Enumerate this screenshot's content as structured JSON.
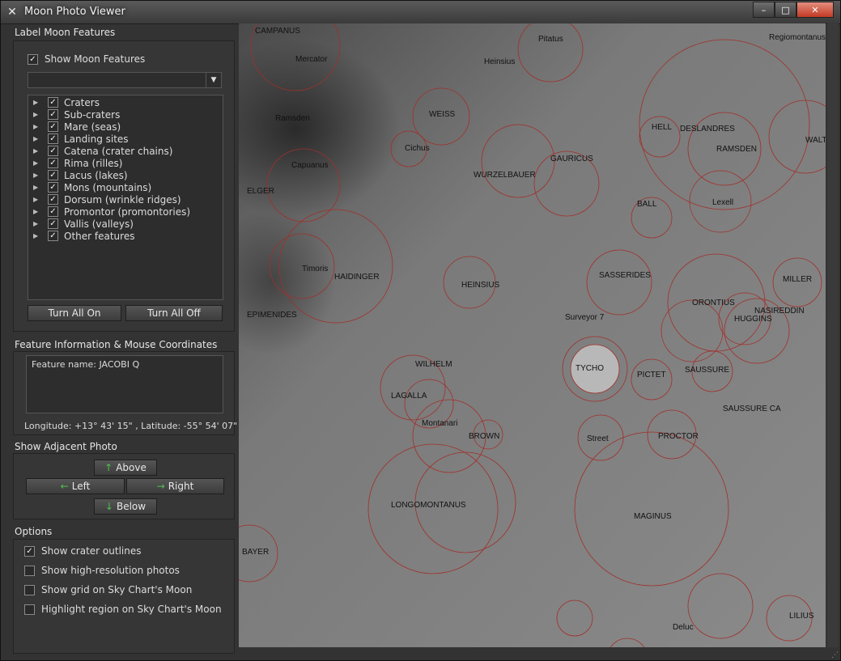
{
  "window": {
    "title": "Moon Photo Viewer",
    "minimize": "–",
    "maximize": "□",
    "close": "✕",
    "app_icon": "x-logo-icon"
  },
  "label_features": {
    "title": "Label Moon Features",
    "show_label": "Show Moon Features",
    "show_checked": true,
    "combo_value": "",
    "tree": [
      {
        "label": "Craters",
        "checked": true
      },
      {
        "label": "Sub-craters",
        "checked": true
      },
      {
        "label": "Mare (seas)",
        "checked": true
      },
      {
        "label": "Landing sites",
        "checked": true
      },
      {
        "label": "Catena (crater chains)",
        "checked": true
      },
      {
        "label": "Rima (rilles)",
        "checked": true
      },
      {
        "label": "Lacus (lakes)",
        "checked": true
      },
      {
        "label": "Mons (mountains)",
        "checked": true
      },
      {
        "label": "Dorsum (wrinkle ridges)",
        "checked": true
      },
      {
        "label": "Promontor (promontories)",
        "checked": true
      },
      {
        "label": "Vallis (valleys)",
        "checked": true
      },
      {
        "label": "Other features",
        "checked": true
      }
    ],
    "turn_all_on": "Turn All On",
    "turn_all_off": "Turn All Off"
  },
  "feature_info": {
    "title": "Feature Information & Mouse Coordinates",
    "feature_name": "Feature name: JACOBI Q",
    "coordinates": "Longitude: +13° 43' 15\" , Latitude: -55° 54' 07\""
  },
  "adjacent": {
    "title": "Show Adjacent Photo",
    "above": "Above",
    "left": "Left",
    "right": "Right",
    "below": "Below"
  },
  "options": {
    "title": "Options",
    "items": [
      {
        "label": "Show crater outlines",
        "checked": true
      },
      {
        "label": "Show high-resolution photos",
        "checked": false
      },
      {
        "label": "Show grid on Sky Chart's Moon",
        "checked": false
      },
      {
        "label": "Highlight region on Sky Chart's Moon",
        "checked": false
      }
    ]
  },
  "map_labels": [
    "CAMPANUS",
    "Mercator",
    "Heinsius",
    "Pitatus",
    "Regiomontanus",
    "WEISS",
    "Ramsden",
    "Cichus",
    "WURZELBAUER",
    "GAURICUS",
    "HELL",
    "DESLANDRES",
    "RAMSDEN",
    "WALTER",
    "Capuanus",
    "ELGER",
    "BALL",
    "Lexell",
    "HAIDINGER",
    "Timoris",
    "HEINSIUS",
    "SASSERIDES",
    "ORONTIUS",
    "MILLER",
    "NASIREDDIN",
    "HUGGINS",
    "EPIMENIDES",
    "Surveyor 7",
    "TYCHO",
    "PICTET",
    "SAUSSURE",
    "WILHELM",
    "LAGALLA",
    "Montanari",
    "SAUSSURE CA",
    "BROWN",
    "Street",
    "PROCTOR",
    "LONGOMONTANUS",
    "MAGINUS",
    "BAYER",
    "Deluc",
    "LILIUS"
  ]
}
